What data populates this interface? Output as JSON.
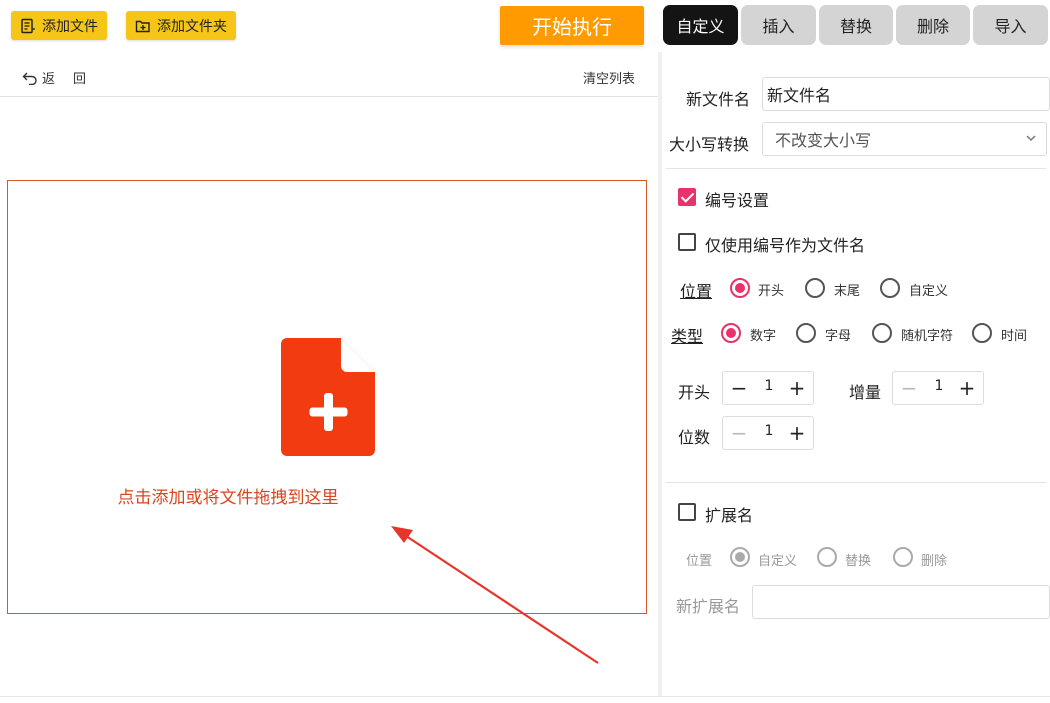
{
  "toolbar": {
    "add_file": "添加文件",
    "add_folder": "添加文件夹",
    "start": "开始执行"
  },
  "tabs": [
    {
      "label": "自定义",
      "active": true
    },
    {
      "label": "插入",
      "active": false
    },
    {
      "label": "替换",
      "active": false
    },
    {
      "label": "删除",
      "active": false
    },
    {
      "label": "导入",
      "active": false
    }
  ],
  "subbar": {
    "back": "返",
    "back2": "回",
    "clear": "清空列表"
  },
  "dropzone": {
    "text": "点击添加或将文件拖拽到这里"
  },
  "panel": {
    "new_name_label": "新文件名",
    "new_name_value": "新文件名",
    "case_label": "大小写转换",
    "case_value": "不改变大小写",
    "numbering_label": "编号设置",
    "numbering_checked": true,
    "only_number_label": "仅使用编号作为文件名",
    "only_number_checked": false,
    "position": {
      "label": "位置",
      "options": [
        "开头",
        "末尾",
        "自定义"
      ],
      "selected": "开头"
    },
    "type": {
      "label": "类型",
      "options": [
        "数字",
        "字母",
        "随机字符",
        "时间"
      ],
      "selected": "数字"
    },
    "start": {
      "label": "开头",
      "value": "1"
    },
    "increment": {
      "label": "增量",
      "value": "1"
    },
    "digits": {
      "label": "位数",
      "value": "1"
    },
    "ext_label": "扩展名",
    "ext_checked": false,
    "ext_position": {
      "label": "位置",
      "options": [
        "自定义",
        "替换",
        "删除"
      ],
      "selected": "自定义"
    },
    "new_ext_label": "新扩展名",
    "new_ext_value": ""
  },
  "colors": {
    "accent": "#e9326b",
    "drop_border": "#d9572a",
    "file_icon": "#f23b10",
    "start_button": "#ff9a00",
    "toolbar_button": "#f5c518"
  }
}
